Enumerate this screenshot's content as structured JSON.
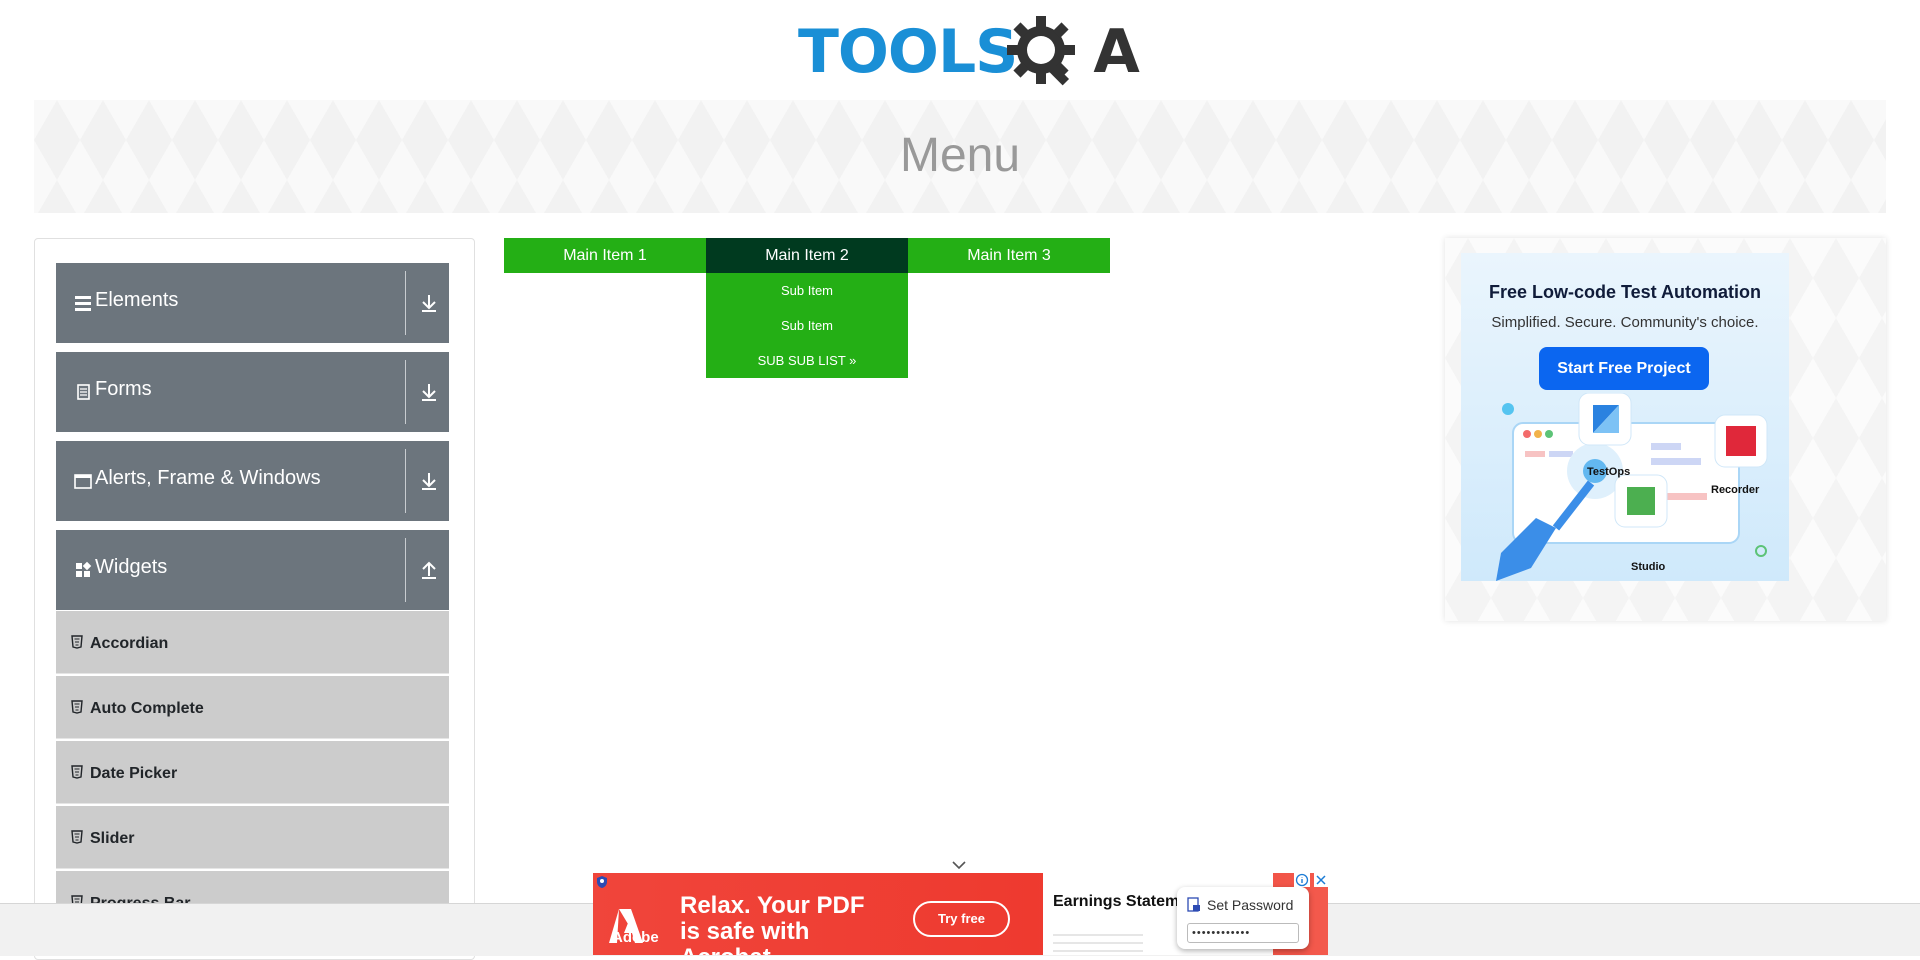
{
  "logo": {
    "part1": "TOOLS",
    "part2": "A"
  },
  "banner": {
    "title": "Menu"
  },
  "sidebar": {
    "groups": [
      {
        "label": "Elements",
        "icon": "hamburger-icon",
        "state": "collapsed"
      },
      {
        "label": "Forms",
        "icon": "document-icon",
        "state": "collapsed"
      },
      {
        "label": "Alerts, Frame & Windows",
        "icon": "window-icon",
        "state": "collapsed"
      },
      {
        "label": "Widgets",
        "icon": "widgets-icon",
        "state": "expanded"
      }
    ],
    "items": [
      {
        "label": "Accordian"
      },
      {
        "label": "Auto Complete"
      },
      {
        "label": "Date Picker"
      },
      {
        "label": "Slider"
      },
      {
        "label": "Progress Bar"
      }
    ]
  },
  "nav": {
    "items": [
      {
        "label": "Main Item 1"
      },
      {
        "label": "Main Item 2"
      },
      {
        "label": "Main Item 3"
      }
    ],
    "submenu": [
      {
        "label": "Sub Item"
      },
      {
        "label": "Sub Item"
      },
      {
        "label": "SUB SUB LIST »"
      }
    ]
  },
  "ad_right": {
    "title": "Free Low-code Test Automation",
    "subtitle": "Simplified. Secure. Community's choice.",
    "cta": "Start Free Project",
    "labels": {
      "testops": "TestOps",
      "recorder": "Recorder",
      "studio": "Studio"
    },
    "colors": {
      "cta": "#0b66f0"
    }
  },
  "ad_bottom": {
    "brand": "Adobe",
    "headline": "Relax. Your PDF is safe with Acrobat.",
    "button": "Try free",
    "doc_title": "Earnings Statement",
    "password_title": "Set Password",
    "password_value": "••••••••••••"
  },
  "colors": {
    "nav_green": "#24af15",
    "nav_active": "#003a1f",
    "sidebar_header": "#6c757d",
    "sidebar_item": "#cccccc",
    "logo_blue": "#1a8fd6"
  }
}
